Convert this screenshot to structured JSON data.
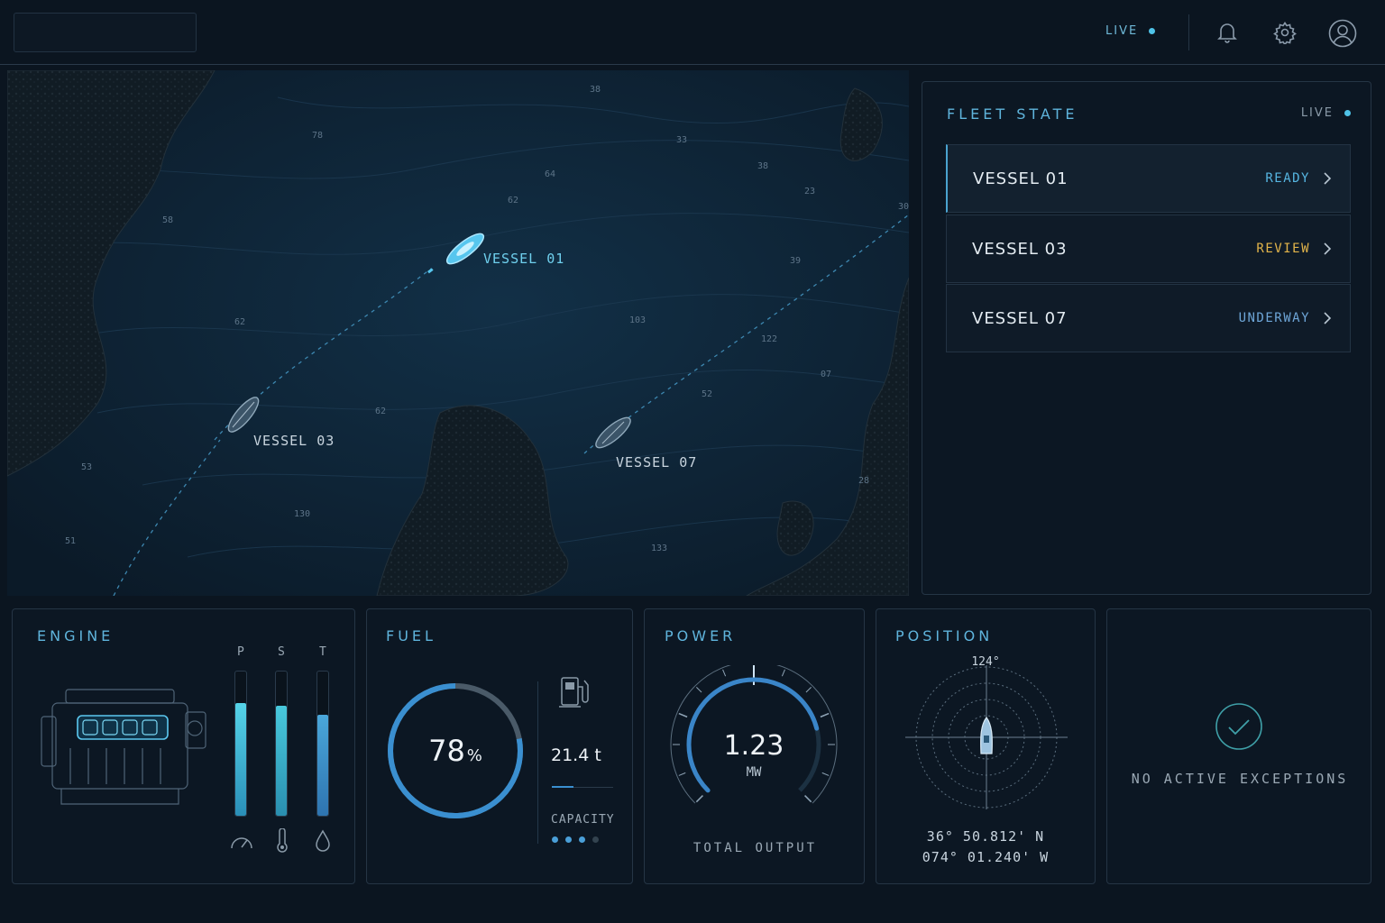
{
  "topbar": {
    "live_label": "LIVE"
  },
  "map": {
    "depth_labels": [
      "38",
      "78",
      "33",
      "64",
      "38",
      "62",
      "23",
      "58",
      "39",
      "62",
      "103",
      "122",
      "07",
      "52",
      "62",
      "53",
      "130",
      "51",
      "133",
      "28",
      "30"
    ],
    "vessels": [
      {
        "label": "VESSEL 01",
        "active": true
      },
      {
        "label": "VESSEL 03",
        "active": false
      },
      {
        "label": "VESSEL 07",
        "active": false
      }
    ]
  },
  "fleet": {
    "title": "FLEET STATE",
    "live_label": "LIVE",
    "rows": [
      {
        "name": "VESSEL 01",
        "status": "READY",
        "status_color": "#56b6e2"
      },
      {
        "name": "VESSEL 03",
        "status": "REVIEW",
        "status_color": "#e2b44a"
      },
      {
        "name": "VESSEL 07",
        "status": "UNDERWAY",
        "status_color": "#6ea6d8"
      }
    ]
  },
  "engine": {
    "title": "ENGINE",
    "bars": [
      {
        "label": "P",
        "level": 0.78
      },
      {
        "label": "S",
        "level": 0.76
      },
      {
        "label": "T",
        "level": 0.7
      }
    ],
    "icons": [
      "gauge-icon",
      "thermometer-icon",
      "drop-icon"
    ]
  },
  "fuel": {
    "title": "FUEL",
    "percent": "78",
    "percent_unit": "%",
    "percent_value": 78,
    "amount": "21.4 t",
    "capacity_label": "CAPACITY",
    "capacity_dots": 4,
    "capacity_dots_active": 3
  },
  "power": {
    "title": "POWER",
    "value": "1.23",
    "unit": "MW",
    "caption": "TOTAL OUTPUT",
    "gauge_fraction": 0.78
  },
  "position": {
    "title": "POSITION",
    "heading": "124°",
    "lat": "36° 50.812' N",
    "lon": "074° 01.240' W"
  },
  "exceptions": {
    "message": "NO ACTIVE EXCEPTIONS"
  },
  "colors": {
    "accent": "#5fb4dc",
    "ready": "#56b6e2",
    "review": "#e2b44a",
    "underway": "#6ea6d8"
  }
}
